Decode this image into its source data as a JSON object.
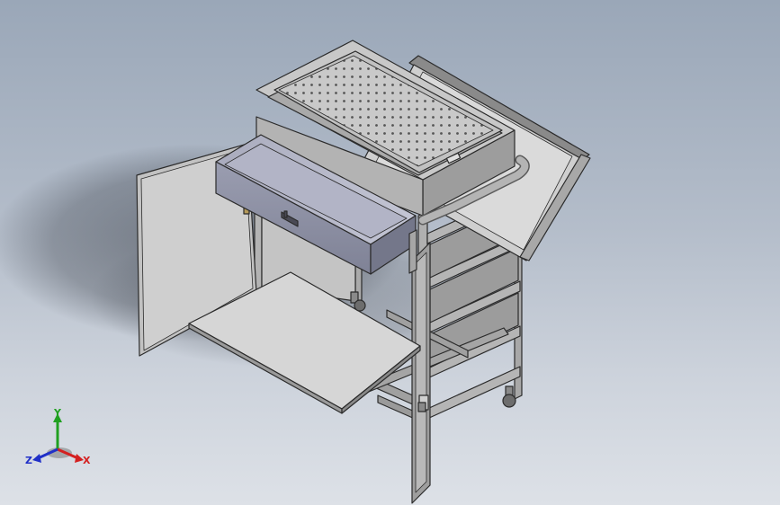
{
  "view": {
    "colors": {
      "background_top": "#9aa7b8",
      "background_bottom": "#dde1e7",
      "metal": "#b8b8b8",
      "metal_dark": "#6f6f6f",
      "edge": "#2b2b2b",
      "drawer": "#8c8fa1",
      "panel": "#d8d8d8"
    }
  },
  "triad": {
    "x_label": "X",
    "y_label": "Y",
    "z_label": "Z",
    "x_color": "#d42020",
    "y_color": "#20a020",
    "z_color": "#2030c8"
  }
}
